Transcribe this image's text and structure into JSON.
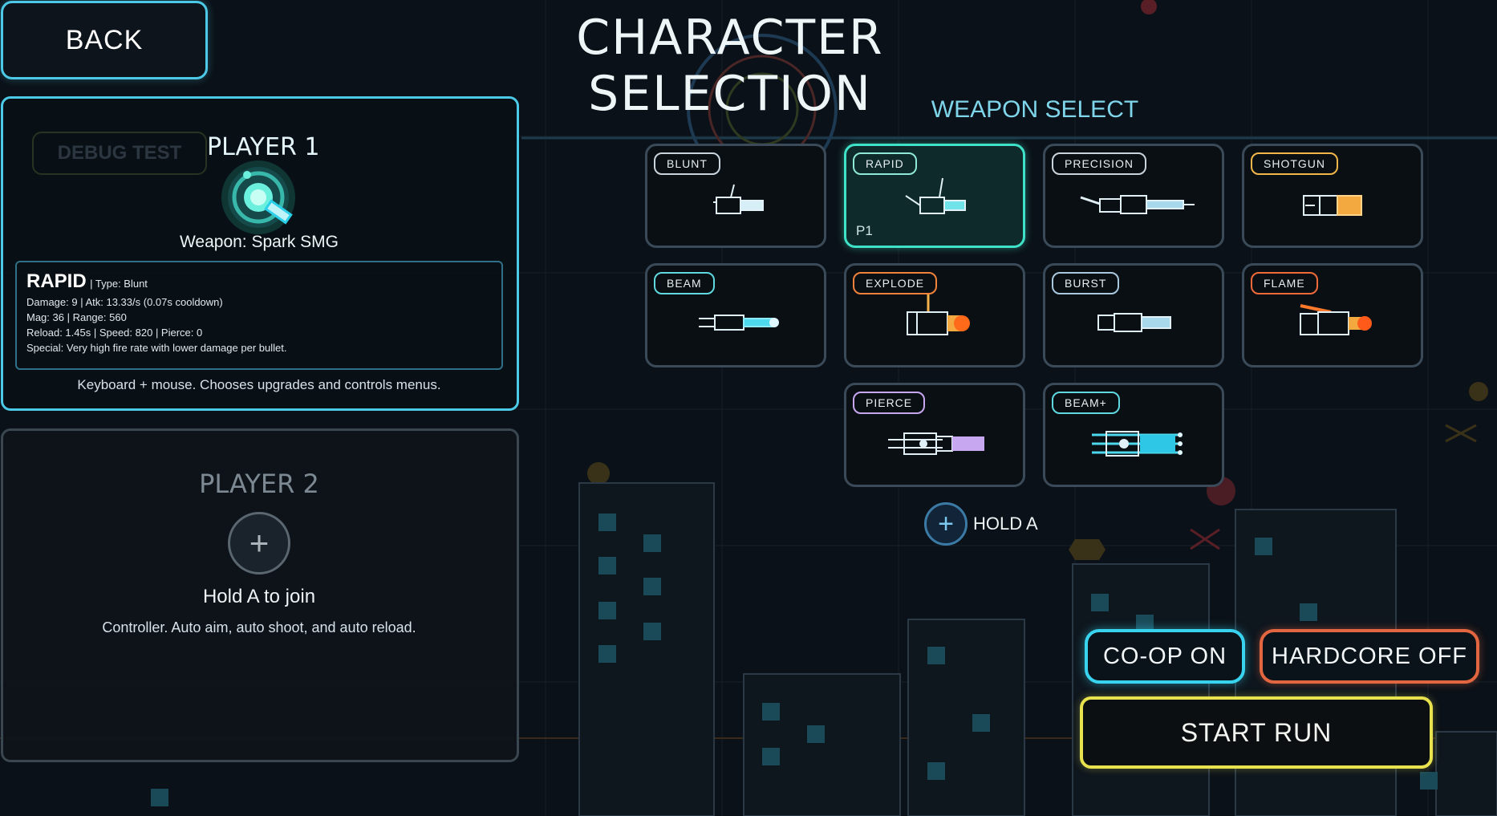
{
  "header": {
    "back_label": "BACK",
    "title": "CHARACTER SELECTION"
  },
  "player1": {
    "title": "PLAYER 1",
    "debug_label": "DEBUG TEST",
    "weapon_line": "Weapon: Spark SMG",
    "stats": {
      "name": "RAPID",
      "type": "|  Type: Blunt",
      "line1": "Damage: 9  |  Atk: 13.33/s (0.07s cooldown)",
      "line2": "Mag: 36  |  Range: 560",
      "line3": "Reload: 1.45s  |  Speed: 820  |  Pierce: 0",
      "line4": "Special: Very high fire rate with lower damage per bullet."
    },
    "help": "Keyboard + mouse. Chooses upgrades and controls menus.",
    "accent": "#4cc9e6"
  },
  "player2": {
    "title": "PLAYER 2",
    "plus_symbol": "+",
    "join_label": "Hold A to join",
    "help": "Controller. Auto aim, auto shoot, and auto reload."
  },
  "weapon_select": {
    "title": "WEAPON SELECT",
    "weapons": [
      {
        "label": "BLUNT",
        "tag_color": "#c9d4dc",
        "icon": "blunt-gun-icon"
      },
      {
        "label": "RAPID",
        "tag_color": "#8fe8d8",
        "icon": "rapid-gun-icon",
        "selected": true,
        "player_tag": "P1"
      },
      {
        "label": "PRECISION",
        "tag_color": "#c9d4dc",
        "icon": "precision-gun-icon"
      },
      {
        "label": "SHOTGUN",
        "tag_color": "#f2b648",
        "icon": "shotgun-icon"
      },
      {
        "label": "BEAM",
        "tag_color": "#5fd8e0",
        "icon": "beam-gun-icon"
      },
      {
        "label": "EXPLODE",
        "tag_color": "#f0823c",
        "icon": "explode-gun-icon"
      },
      {
        "label": "BURST",
        "tag_color": "#a9c8de",
        "icon": "burst-gun-icon"
      },
      {
        "label": "FLAME",
        "tag_color": "#f06a3a",
        "icon": "flame-gun-icon"
      },
      {
        "label": "PIERCE",
        "tag_color": "#c7a7f0",
        "icon": "pierce-gun-icon"
      },
      {
        "label": "BEAM+",
        "tag_color": "#5fd8e0",
        "icon": "beam-plus-gun-icon"
      }
    ],
    "hold_plus": "+",
    "hold_label": "HOLD A"
  },
  "controls": {
    "coop_label": "CO-OP  ON",
    "hardcore_label": "HARDCORE  OFF",
    "start_label": "START RUN"
  },
  "colors": {
    "background": "#0b1118",
    "selected_card": "#3fe2c8",
    "coop": "#38d3ee",
    "hardcore": "#e2663f",
    "start": "#e8e24e"
  }
}
